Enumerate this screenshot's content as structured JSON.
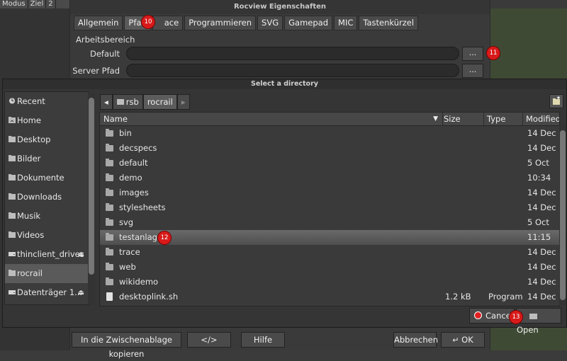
{
  "background": {
    "toolbar_items": [
      "Modus",
      "Ziel",
      "2"
    ]
  },
  "props": {
    "title": "Rocview Eigenschaften",
    "tabs": [
      "Allgemein",
      "Pfad",
      "ace",
      "Programmieren",
      "SVG",
      "Gamepad",
      "MIC",
      "Tastenkürzel"
    ],
    "active_tab": "Pfad",
    "section": "Arbeitsbereich",
    "fields": [
      {
        "label": "Default",
        "value": "",
        "button": "..."
      },
      {
        "label": "Server Pfad",
        "value": "",
        "button": "..."
      }
    ],
    "bottom_buttons": {
      "copy": "In die Zwischenablage kopieren",
      "code": "</>",
      "help": "Hilfe",
      "cancel": "Abbrechen",
      "ok": "OK"
    },
    "badges": {
      "tab": "10",
      "field": "11"
    }
  },
  "chooser": {
    "title": "Select a directory",
    "places": [
      {
        "label": "Recent",
        "icon": "recent-icon"
      },
      {
        "label": "Home",
        "icon": "home-folder-icon"
      },
      {
        "label": "Desktop",
        "icon": "folder-icon"
      },
      {
        "label": "Bilder",
        "icon": "folder-icon"
      },
      {
        "label": "Dokumente",
        "icon": "folder-icon"
      },
      {
        "label": "Downloads",
        "icon": "folder-icon"
      },
      {
        "label": "Musik",
        "icon": "folder-icon"
      },
      {
        "label": "Videos",
        "icon": "folder-icon"
      },
      {
        "label": "thinclient_drives",
        "icon": "drive-icon",
        "eject": true
      },
      {
        "label": "rocrail",
        "icon": "folder-icon",
        "selected": true
      },
      {
        "label": "Datenträger 1...",
        "icon": "drive-icon",
        "eject": true
      }
    ],
    "path": [
      "rsb",
      "rocrail"
    ],
    "columns": {
      "name": "Name",
      "size": "Size",
      "type": "Type",
      "modified": "Modified"
    },
    "files": [
      {
        "name": "bin",
        "size": "",
        "type": "",
        "modified": "14 Dec"
      },
      {
        "name": "decspecs",
        "size": "",
        "type": "",
        "modified": "14 Dec"
      },
      {
        "name": "default",
        "size": "",
        "type": "",
        "modified": "5 Oct"
      },
      {
        "name": "demo",
        "size": "",
        "type": "",
        "modified": "10:34"
      },
      {
        "name": "images",
        "size": "",
        "type": "",
        "modified": "14 Dec"
      },
      {
        "name": "stylesheets",
        "size": "",
        "type": "",
        "modified": "14 Dec"
      },
      {
        "name": "svg",
        "size": "",
        "type": "",
        "modified": "5 Oct"
      },
      {
        "name": "testanlage",
        "size": "",
        "type": "",
        "modified": "11:15",
        "selected": true
      },
      {
        "name": "trace",
        "size": "",
        "type": "",
        "modified": "14 Dec"
      },
      {
        "name": "web",
        "size": "",
        "type": "",
        "modified": "14 Dec"
      },
      {
        "name": "wikidemo",
        "size": "",
        "type": "",
        "modified": "14 Dec"
      },
      {
        "name": "desktoplink.sh",
        "size": "1.2 kB",
        "type": "Program",
        "modified": "14 Dec",
        "file": true
      }
    ],
    "buttons": {
      "cancel": "Cancel",
      "open": "Open"
    },
    "badges": {
      "row": "12",
      "button": "13"
    }
  }
}
